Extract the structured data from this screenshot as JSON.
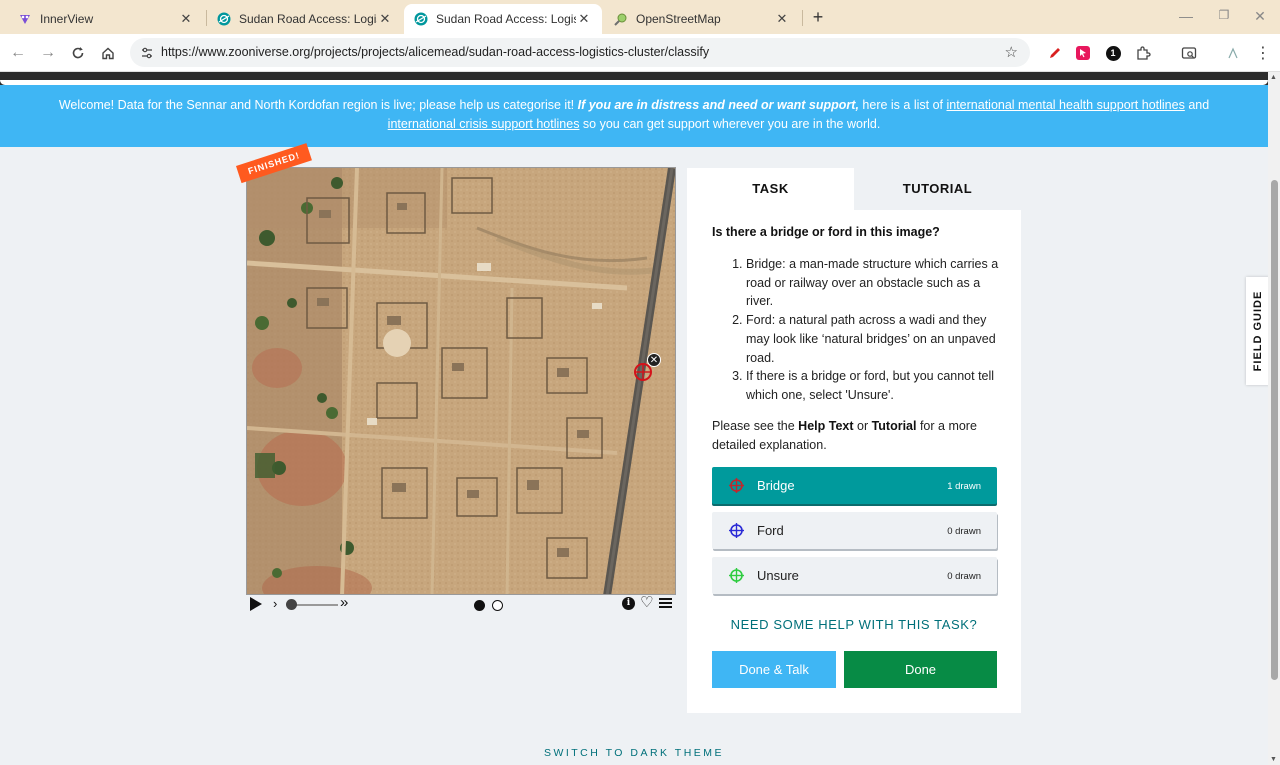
{
  "browser": {
    "tabs": [
      {
        "title": "InnerView",
        "close": "✕"
      },
      {
        "title": "Sudan Road Access: Logistics C",
        "close": "✕"
      },
      {
        "title": "Sudan Road Access: Logistics C",
        "close": "✕",
        "active": true
      },
      {
        "title": "OpenStreetMap",
        "close": "✕"
      }
    ],
    "new_tab": "+",
    "url": "https://www.zooniverse.org/projects/projects/alicemead/sudan-road-access-logistics-cluster/classify",
    "extension_badge": "1"
  },
  "banner": {
    "text_1": "Welcome! Data for the Sennar and North Kordofan region is live; please help us categorise it! ",
    "text_2_emph": "If you are in distress and need or want support,",
    "text_3": " here is a list of ",
    "link_1": "international mental health support hotlines",
    "text_4": " and ",
    "link_2": "international crisis support hotlines",
    "text_5": " so you can get support wherever you are in the world."
  },
  "viewer": {
    "status_ribbon": "FINISHED!",
    "remove_mark": "✕",
    "slower": "›",
    "faster": "»",
    "info": "i",
    "favorite": "♡"
  },
  "panel": {
    "tabs": [
      "TASK",
      "TUTORIAL"
    ],
    "question": "Is there a bridge or ford in this image?",
    "instructions": [
      "Bridge: a man-made structure which carries a road or railway over an obstacle such as a river.",
      "Ford: a natural path across a wadi and they may look like ‘natural bridges’ on an unpaved road.",
      "If there is a bridge or ford, but you cannot tell which one, select 'Unsure'."
    ],
    "see_1": "Please see the ",
    "help_text": "Help Text",
    "see_2": " or ",
    "tutorial": "Tutorial",
    "see_3": " for a more detailed explanation.",
    "choices": [
      {
        "label": "Bridge",
        "count": "1 drawn",
        "color": "#c1272d"
      },
      {
        "label": "Ford",
        "count": "0 drawn",
        "color": "#2b2bd6"
      },
      {
        "label": "Unsure",
        "count": "0 drawn",
        "color": "#2ecc40"
      }
    ],
    "help_link": "NEED SOME HELP WITH THIS TASK?",
    "done_talk": "Done & Talk",
    "done": "Done"
  },
  "field_guide": "FIELD GUIDE",
  "dark_theme": "SWITCH TO DARK THEME",
  "colors": {
    "banner": "#3fb6f4",
    "selected_choice": "#009a9c",
    "done": "#078b45",
    "ribbon": "#ff5a1f"
  }
}
